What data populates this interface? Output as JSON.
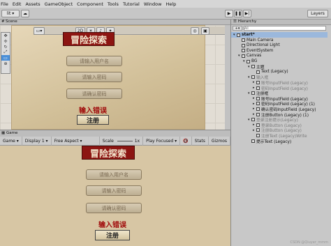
{
  "menu": [
    "File",
    "Edit",
    "Assets",
    "GameObject",
    "Component",
    "Tools",
    "Tutorial",
    "Window",
    "Help"
  ],
  "toolbar": {
    "account": "lit",
    "layers_label": "Layers",
    "play_icons": [
      "play-icon",
      "pause-icon",
      "step-icon"
    ]
  },
  "scene": {
    "tab": "Scene",
    "mode2d": "2D",
    "tools": [
      "✥",
      "✢",
      "↻",
      "⤢",
      "▭",
      "⊕"
    ]
  },
  "ui": {
    "title": "冒险探索",
    "username_placeholder": "请输入用户名",
    "password_placeholder": "请输入密码",
    "confirm_placeholder": "请确认密码",
    "error_text": "输入错误",
    "register_label": "注册"
  },
  "game": {
    "tab": "Game",
    "mode": "Game",
    "display": "Display 1",
    "aspect": "Free Aspect",
    "scale_label": "Scale",
    "scale_value": "1x",
    "play_focused": "Play Focused",
    "stats": "Stats",
    "gizmos": "Gizmos"
  },
  "hierarchy": {
    "tab": "Hierarchy",
    "search_placeholder": "All",
    "items": [
      {
        "label": "start*",
        "depth": 0,
        "expanded": true,
        "bold": true,
        "dim": false
      },
      {
        "label": "Main Camera",
        "depth": 1,
        "expanded": null,
        "dim": false
      },
      {
        "label": "Directional Light",
        "depth": 1,
        "expanded": null,
        "dim": false
      },
      {
        "label": "EventSystem",
        "depth": 1,
        "expanded": null,
        "dim": false
      },
      {
        "label": "Canvas",
        "depth": 1,
        "expanded": true,
        "dim": false
      },
      {
        "label": "BG",
        "depth": 2,
        "expanded": true,
        "dim": false
      },
      {
        "label": "主题",
        "depth": 3,
        "expanded": true,
        "dim": false
      },
      {
        "label": "Text (Legacy)",
        "depth": 4,
        "expanded": null,
        "dim": false
      },
      {
        "label": "输入框",
        "depth": 3,
        "expanded": true,
        "dim": true
      },
      {
        "label": "账号InputField (Legacy)",
        "depth": 4,
        "expanded": false,
        "dim": true
      },
      {
        "label": "密码InputField (Legacy)",
        "depth": 4,
        "expanded": false,
        "dim": true
      },
      {
        "label": "注册框",
        "depth": 3,
        "expanded": true,
        "dim": false
      },
      {
        "label": "账号InputField (Legacy)",
        "depth": 4,
        "expanded": false,
        "dim": false
      },
      {
        "label": "密码InputField (Legacy) (1)",
        "depth": 4,
        "expanded": false,
        "dim": false
      },
      {
        "label": "确认密码InputField (Legacy)",
        "depth": 4,
        "expanded": false,
        "dim": false
      },
      {
        "label": "注册Button (Legacy) (1)",
        "depth": 4,
        "expanded": false,
        "dim": false
      },
      {
        "label": "登录注册提示(Legacy)",
        "depth": 3,
        "expanded": true,
        "dim": true
      },
      {
        "label": "登录Button (Legacy)",
        "depth": 4,
        "expanded": false,
        "dim": true
      },
      {
        "label": "注册Button (Legacy)",
        "depth": 4,
        "expanded": false,
        "dim": true
      },
      {
        "label": "注册Text (Legacy)Write",
        "depth": 4,
        "expanded": null,
        "dim": true
      },
      {
        "label": "提示Text (Legacy)",
        "depth": 3,
        "expanded": null,
        "dim": false
      }
    ]
  },
  "watermark": "CSDN @Qiuyer_mmm",
  "colors": {
    "title_bg": "#8c1512",
    "error": "#a00c0c",
    "panel": "#d7c6a4"
  }
}
